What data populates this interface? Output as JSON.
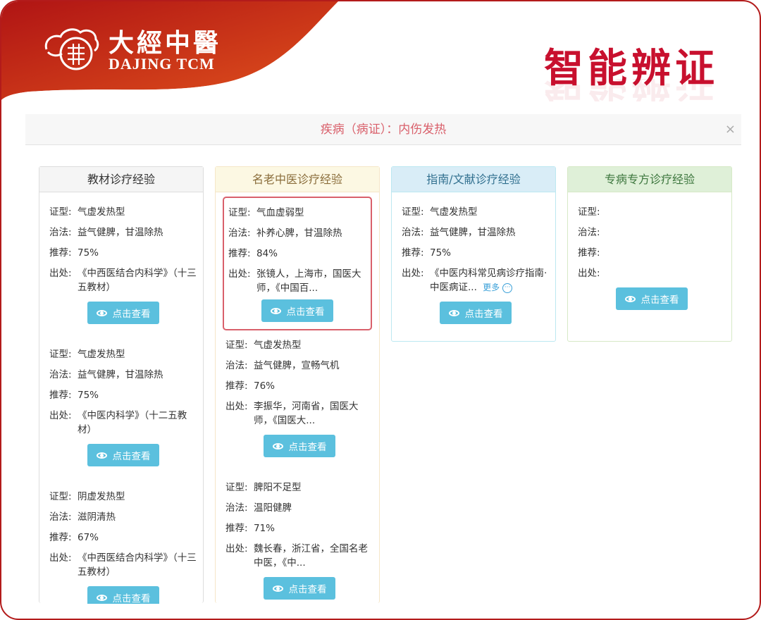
{
  "header": {
    "brand_cn": "大經中醫",
    "brand_en": "DAJING TCM",
    "title": "智能辨证"
  },
  "disease_bar": {
    "text": "疾病（病证）：内伤发热",
    "close": "×"
  },
  "columns": [
    {
      "title": "教材诊疗经验",
      "entries": [
        {
          "zhengxing": "气虚发热型",
          "zhifa": "益气健脾，甘温除热",
          "tuijian": "75%",
          "chuchu": "《中西医结合内科学》（十三五教材）"
        },
        {
          "zhengxing": "气虚发热型",
          "zhifa": "益气健脾，甘温除热",
          "tuijian": "75%",
          "chuchu": "《中医内科学》（十二五教材）"
        },
        {
          "zhengxing": "阴虚发热型",
          "zhifa": "滋阴清热",
          "tuijian": "67%",
          "chuchu": "《中西医结合内科学》（十三五教材）"
        }
      ]
    },
    {
      "title": "名老中医诊疗经验",
      "entries": [
        {
          "zhengxing": "气血虚弱型",
          "zhifa": "补养心脾，甘温除热",
          "tuijian": "84%",
          "chuchu": "张镜人，上海市，国医大师，《中国百..."
        },
        {
          "zhengxing": "气虚发热型",
          "zhifa": "益气健脾，宣畅气机",
          "tuijian": "76%",
          "chuchu": "李振华，河南省，国医大师，《国医大..."
        },
        {
          "zhengxing": "脾阳不足型",
          "zhifa": "温阳健脾",
          "tuijian": "71%",
          "chuchu": "魏长春，浙江省，全国名老中医，《中..."
        }
      ]
    },
    {
      "title": "指南/文献诊疗经验",
      "entries": [
        {
          "zhengxing": "气虚发热型",
          "zhifa": "益气健脾，甘温除热",
          "tuijian": "75%",
          "chuchu": "《中医内科常见病诊疗指南·中医病证...",
          "more": "更多"
        }
      ]
    },
    {
      "title": "专病专方诊疗经验",
      "entries": [
        {
          "zhengxing": "",
          "zhifa": "",
          "tuijian": "",
          "chuchu": ""
        }
      ]
    }
  ],
  "labels": {
    "zhengxing": "证型:",
    "zhifa": "治法:",
    "tuijian": "推荐:",
    "chuchu": "出处:",
    "view_button": "点击查看"
  },
  "colors": {
    "brand_red": "#b31b1b",
    "title_red": "#c8102e",
    "button": "#5bc0de",
    "highlight": "#d9606b",
    "col1_head_bg": "#f5f5f5",
    "col2_head_bg": "#fcf8e3",
    "col3_head_bg": "#d9edf7",
    "col4_head_bg": "#dff0d8"
  }
}
